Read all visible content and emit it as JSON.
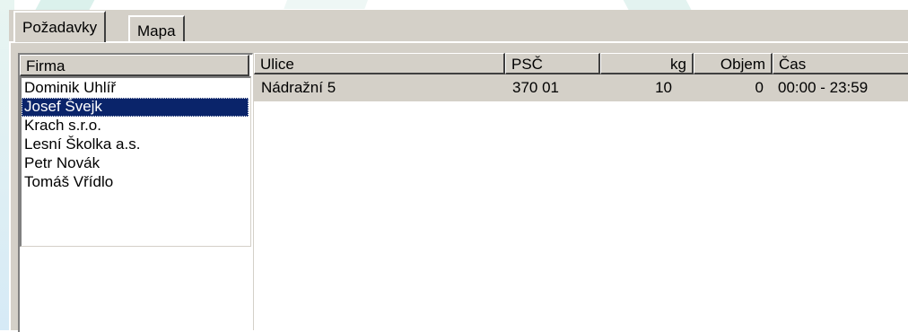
{
  "tabs": [
    {
      "label": "Požadavky",
      "active": true
    },
    {
      "label": "Mapa",
      "active": false
    }
  ],
  "company_list": {
    "header": "Firma",
    "items": [
      {
        "label": "Dominik Uhlíř"
      },
      {
        "label": "Josef Švejk",
        "selected": true
      },
      {
        "label": "Krach s.r.o."
      },
      {
        "label": "Lesní Školka a.s."
      },
      {
        "label": "Petr Novák"
      },
      {
        "label": "Tomáš Vřídlo"
      }
    ]
  },
  "grid": {
    "columns": [
      "Ulice",
      "PSČ",
      "kg",
      "Objem",
      "Čas"
    ],
    "rows": [
      {
        "ulice": "Nádražní 5",
        "psc": "370 01",
        "kg": "10",
        "objem": "0",
        "cas": "00:00 - 23:59"
      }
    ]
  },
  "colors": {
    "selection": "#0a246a",
    "window_face": "#d4d0c8"
  }
}
